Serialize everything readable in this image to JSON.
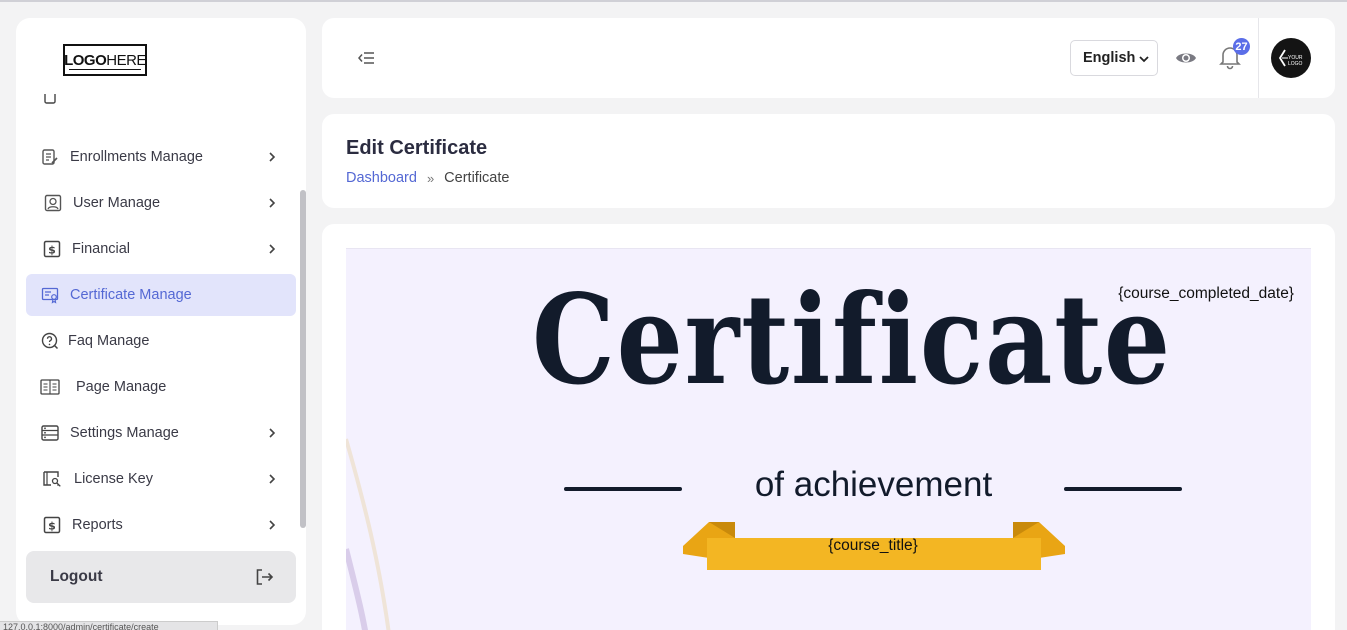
{
  "sidebar": {
    "logo_bold": "LOGO",
    "logo_light": "HERE",
    "items": [
      {
        "label": "Enrollments Manage",
        "icon": "enrollments-icon",
        "chevron": true
      },
      {
        "label": "User Manage",
        "icon": "user-icon",
        "chevron": true
      },
      {
        "label": "Financial",
        "icon": "dollar-icon",
        "chevron": true
      },
      {
        "label": "Certificate Manage",
        "icon": "certificate-icon",
        "chevron": false,
        "active": true
      },
      {
        "label": "Faq Manage",
        "icon": "question-icon",
        "chevron": false
      },
      {
        "label": "Page Manage",
        "icon": "page-icon",
        "chevron": false
      },
      {
        "label": "Settings Manage",
        "icon": "settings-icon",
        "chevron": true
      },
      {
        "label": "License Key",
        "icon": "license-icon",
        "chevron": true
      },
      {
        "label": "Reports",
        "icon": "dollar-icon",
        "chevron": true
      }
    ],
    "logout_label": "Logout"
  },
  "header": {
    "language": "English",
    "notification_count": "27",
    "avatar_text": "YOUR LOGO"
  },
  "page": {
    "title": "Edit Certificate",
    "breadcrumb": {
      "home": "Dashboard",
      "separator": "»",
      "current": "Certificate"
    }
  },
  "certificate": {
    "date_placeholder": "{course_completed_date}",
    "heading": "Certificate",
    "subheading": "of achievement",
    "course_placeholder": "{course_title}",
    "colors": {
      "background": "#f4f1fe",
      "ink": "#121b2b",
      "ribbon": "#f3b623"
    }
  },
  "statusbar": {
    "text": "127.0.0.1:8000/admin/certificate/create"
  },
  "colors": {
    "accent": "#5468d4",
    "active_bg": "#e2e4fb",
    "badge": "#5b6ee8"
  }
}
